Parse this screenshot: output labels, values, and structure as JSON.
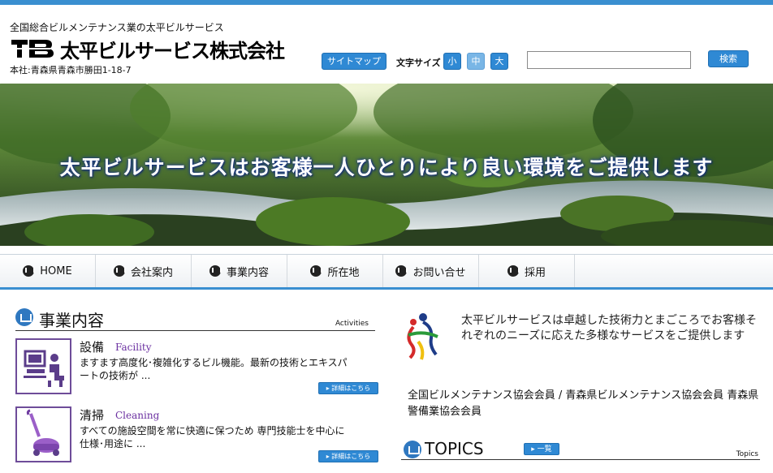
{
  "header": {
    "tagline": "全国総合ビルメンテナンス業の太平ビルサービス",
    "company_name": "太平ビルサービス株式会社",
    "address": "本社:青森県青森市勝田1-18-7",
    "sitemap_label": "サイトマップ",
    "font_size_label": "文字サイズ",
    "font_size_small": "小",
    "font_size_medium": "中",
    "font_size_large": "大",
    "search_placeholder": "",
    "search_label": "検索"
  },
  "banner": {
    "caption": "太平ビルサービスはお客様一人ひとりにより良い環境をご提供します"
  },
  "nav": {
    "items": [
      {
        "label": "HOME"
      },
      {
        "label": "会社案内"
      },
      {
        "label": "事業内容"
      },
      {
        "label": "所在地"
      },
      {
        "label": "お問い合せ"
      },
      {
        "label": "採用"
      }
    ]
  },
  "business": {
    "title": "事業内容",
    "title_en": "Activities",
    "services": [
      {
        "title": "設備",
        "title_en": "Facility",
        "desc": "ますます高度化･複雑化するビル機能。最新の技術とエキスパートの技術が ...",
        "more": "▸ 詳細はこちら",
        "icon": "computer-operator-icon"
      },
      {
        "title": "清掃",
        "title_en": "Cleaning",
        "desc": "すべての施設空間を常に快適に保つため 専門技能士を中心に仕様･用途に ...",
        "more": "▸ 詳細はこちら",
        "icon": "vacuum-cleaner-icon"
      }
    ]
  },
  "intro": {
    "text": "太平ビルサービスは卓越した技術力とまごころでお客様それぞれのニーズに応えた多様なサービスをご提供します",
    "associations": "全国ビルメンテナンス協会会員 / 青森県ビルメンテナンス協会会員 青森県警備業協会会員"
  },
  "topics": {
    "title": "TOPICS",
    "all_label": "▸ 一覧",
    "title_en": "Topics"
  },
  "colors": {
    "accent": "#3a8fd0",
    "button": "#2f89d4",
    "service_border": "#6e4c99",
    "service_en": "#6a2fa0"
  }
}
